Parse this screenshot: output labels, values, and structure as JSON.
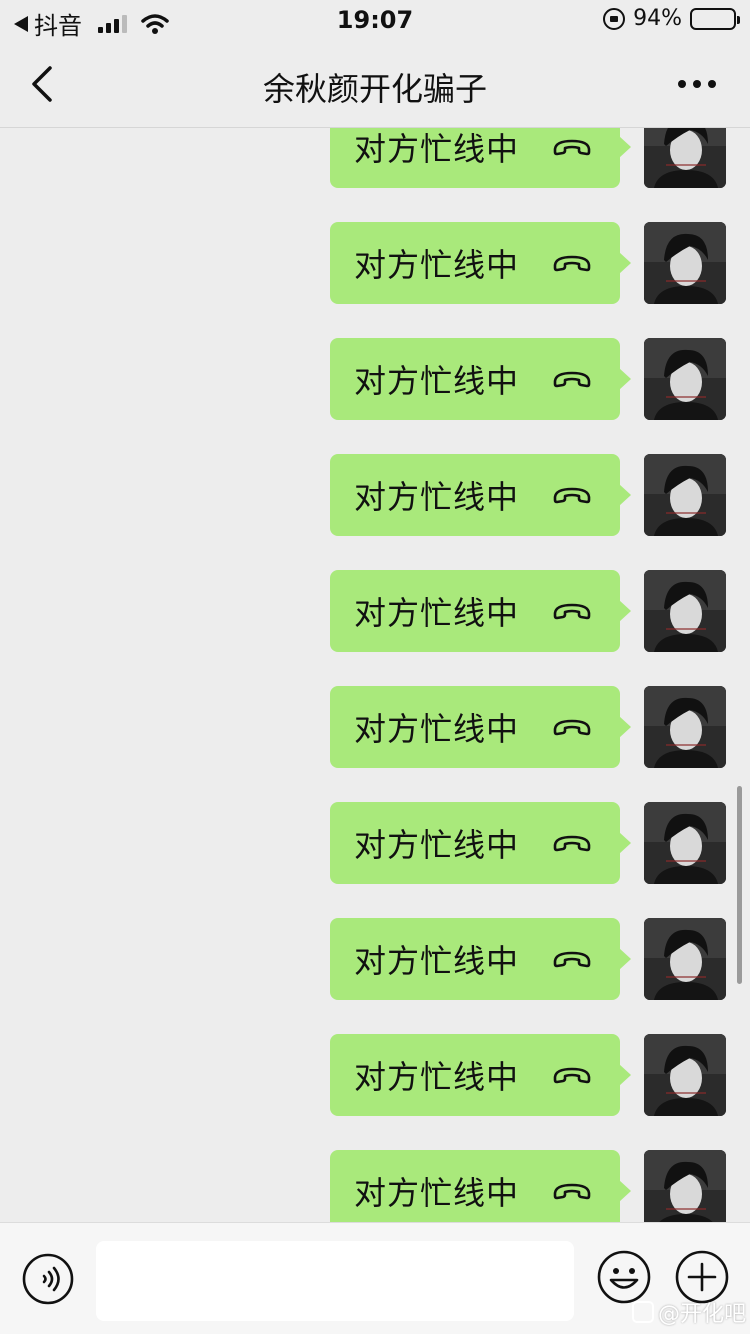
{
  "status_bar": {
    "back_app": "抖音",
    "time": "19:07",
    "battery_percent": "94%",
    "battery_level": 0.94
  },
  "nav": {
    "title": "余秋颜开化骗子"
  },
  "messages": [
    {
      "text": "对方忙线中",
      "icon": "hang-up-phone-icon"
    },
    {
      "text": "对方忙线中",
      "icon": "hang-up-phone-icon"
    },
    {
      "text": "对方忙线中",
      "icon": "hang-up-phone-icon"
    },
    {
      "text": "对方忙线中",
      "icon": "hang-up-phone-icon"
    },
    {
      "text": "对方忙线中",
      "icon": "hang-up-phone-icon"
    },
    {
      "text": "对方忙线中",
      "icon": "hang-up-phone-icon"
    },
    {
      "text": "对方忙线中",
      "icon": "hang-up-phone-icon"
    },
    {
      "text": "对方忙线中",
      "icon": "hang-up-phone-icon"
    },
    {
      "text": "对方忙线中",
      "icon": "hang-up-phone-icon"
    },
    {
      "text": "对方忙线中",
      "icon": "hang-up-phone-icon"
    }
  ],
  "input": {
    "value": ""
  },
  "watermark": "@开化吧",
  "colors": {
    "bubble": "#a9e97b",
    "background": "#ededed",
    "toolbar": "#f6f6f6"
  }
}
